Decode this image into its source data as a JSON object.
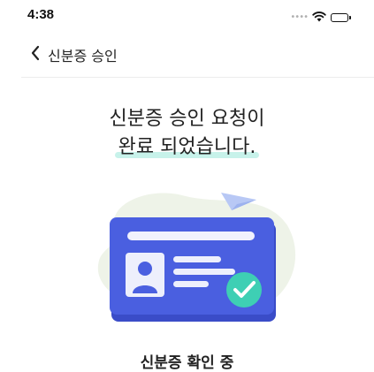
{
  "status_bar": {
    "time": "4:38",
    "icons": [
      "signal-dots-icon",
      "wifi-icon",
      "battery-icon"
    ]
  },
  "nav": {
    "back_icon": "chevron-left-icon",
    "title": "신분증 승인"
  },
  "headline": {
    "line1": "신분증 승인 요청이",
    "line2": "완료 되었습니다."
  },
  "illustration": {
    "icon": "id-card-verified-icon",
    "colors": {
      "card": "#4a5fe0",
      "card_shadow": "#3a4cc8",
      "blob": "#eef3e8",
      "check": "#3ecfb4",
      "plane": "#b8c8f5"
    }
  },
  "caption": "신분증 확인 중",
  "colors": {
    "highlight": "#c7f2ea",
    "divider": "#ececec",
    "text": "#222222"
  }
}
